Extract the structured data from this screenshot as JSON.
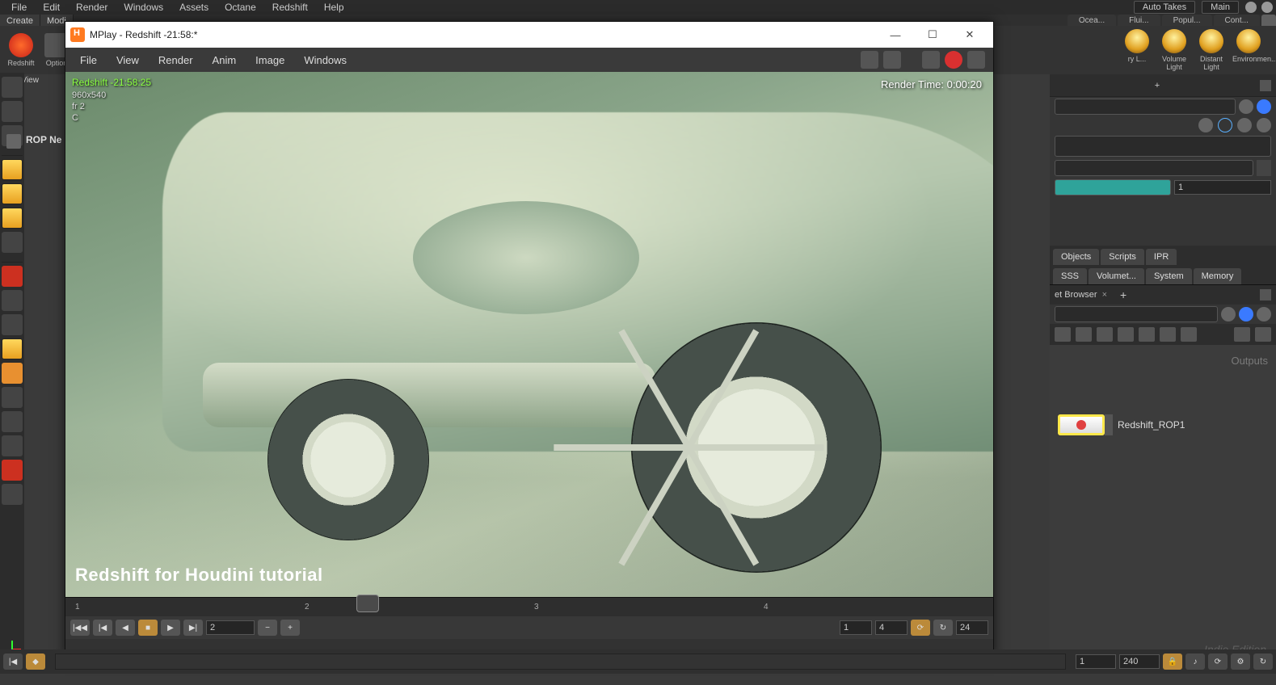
{
  "main_menu": {
    "items": [
      "File",
      "Edit",
      "Render",
      "Windows",
      "Assets",
      "Octane",
      "Redshift",
      "Help"
    ]
  },
  "top_right": {
    "dropdown1": "Auto Takes",
    "dropdown2": "Main"
  },
  "shelf": {
    "create": "Create",
    "modify": "Modi",
    "tabs": [
      "Ocea...",
      "Flui...",
      "Popul...",
      "Cont..."
    ]
  },
  "shelf_tools": {
    "redshift": "Redshift",
    "options": "Option",
    "rylight": "ry L...",
    "volume": "Volume Light",
    "distant": "Distant Light",
    "env": "Environmen..."
  },
  "scene_view": "cene View",
  "rop_label": "ROP Ne",
  "mplay": {
    "title": "MPlay - Redshift -21:58:*",
    "menu": [
      "File",
      "View",
      "Render",
      "Anim",
      "Image",
      "Windows"
    ],
    "overlay_title": "Redshift -21:58:25",
    "overlay_res": "960x540",
    "overlay_frame": "fr 2",
    "overlay_chan": "C",
    "render_time": "Render Time: 0:00:20",
    "tutorial": "Redshift for Houdini tutorial",
    "tl_ticks": [
      "1",
      "2",
      "3",
      "4"
    ],
    "frame_field": "2",
    "field2": "1",
    "field3": "4",
    "field4": "24"
  },
  "right_panel": {
    "tabs1": [
      "Objects",
      "Scripts",
      "IPR"
    ],
    "tabs2": [
      "SSS",
      "Volumet...",
      "System",
      "Memory"
    ],
    "browser_label": "et Browser",
    "output_label": "Outputs",
    "node_name": "Redshift_ROP1",
    "field_val": "1",
    "edition": "Indie Edition"
  },
  "bottom": {
    "start": "1",
    "end": "240"
  }
}
